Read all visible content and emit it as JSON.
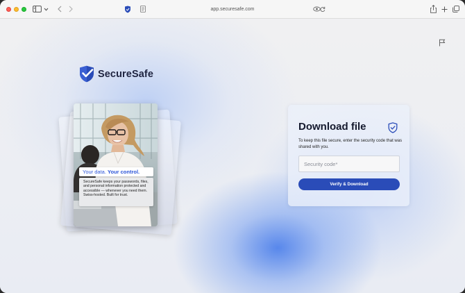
{
  "browser": {
    "address": "app.securesafe.com",
    "icons": [
      "sidebar-icon",
      "chevron-down-icon",
      "chevron-left-icon",
      "chevron-right-icon",
      "shield-icon",
      "reader-icon",
      "privacy-icon",
      "reload-icon",
      "share-icon",
      "plus-icon",
      "tabs-icon"
    ]
  },
  "brand": {
    "name": "SecureSafe",
    "color": "#2a4cb8"
  },
  "promo": {
    "title_lead": "Your data. ",
    "title_strong": "Your control.",
    "body": "SecureSafe keeps your passwords, files, and personal information protected and accessible — whenever you need them. Swiss-hosted. Built for trust."
  },
  "download": {
    "title": "Download file",
    "description": "To keep this file secure, enter the security code that was shared with you.",
    "code_placeholder": "Security code*",
    "code_value": "",
    "button_label": "Verify & Download"
  },
  "colors": {
    "accent": "#2a4cb8",
    "highlight": "#2d55d8"
  }
}
